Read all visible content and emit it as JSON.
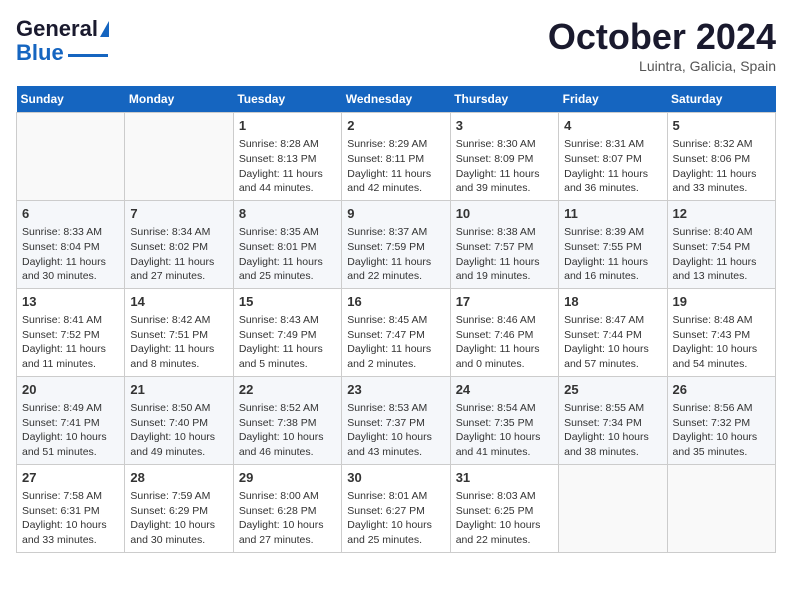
{
  "header": {
    "logo_line1": "General",
    "logo_line2": "Blue",
    "month": "October 2024",
    "location": "Luintra, Galicia, Spain"
  },
  "days_of_week": [
    "Sunday",
    "Monday",
    "Tuesday",
    "Wednesday",
    "Thursday",
    "Friday",
    "Saturday"
  ],
  "weeks": [
    [
      {
        "day": "",
        "info": ""
      },
      {
        "day": "",
        "info": ""
      },
      {
        "day": "1",
        "info": "Sunrise: 8:28 AM\nSunset: 8:13 PM\nDaylight: 11 hours and 44 minutes."
      },
      {
        "day": "2",
        "info": "Sunrise: 8:29 AM\nSunset: 8:11 PM\nDaylight: 11 hours and 42 minutes."
      },
      {
        "day": "3",
        "info": "Sunrise: 8:30 AM\nSunset: 8:09 PM\nDaylight: 11 hours and 39 minutes."
      },
      {
        "day": "4",
        "info": "Sunrise: 8:31 AM\nSunset: 8:07 PM\nDaylight: 11 hours and 36 minutes."
      },
      {
        "day": "5",
        "info": "Sunrise: 8:32 AM\nSunset: 8:06 PM\nDaylight: 11 hours and 33 minutes."
      }
    ],
    [
      {
        "day": "6",
        "info": "Sunrise: 8:33 AM\nSunset: 8:04 PM\nDaylight: 11 hours and 30 minutes."
      },
      {
        "day": "7",
        "info": "Sunrise: 8:34 AM\nSunset: 8:02 PM\nDaylight: 11 hours and 27 minutes."
      },
      {
        "day": "8",
        "info": "Sunrise: 8:35 AM\nSunset: 8:01 PM\nDaylight: 11 hours and 25 minutes."
      },
      {
        "day": "9",
        "info": "Sunrise: 8:37 AM\nSunset: 7:59 PM\nDaylight: 11 hours and 22 minutes."
      },
      {
        "day": "10",
        "info": "Sunrise: 8:38 AM\nSunset: 7:57 PM\nDaylight: 11 hours and 19 minutes."
      },
      {
        "day": "11",
        "info": "Sunrise: 8:39 AM\nSunset: 7:55 PM\nDaylight: 11 hours and 16 minutes."
      },
      {
        "day": "12",
        "info": "Sunrise: 8:40 AM\nSunset: 7:54 PM\nDaylight: 11 hours and 13 minutes."
      }
    ],
    [
      {
        "day": "13",
        "info": "Sunrise: 8:41 AM\nSunset: 7:52 PM\nDaylight: 11 hours and 11 minutes."
      },
      {
        "day": "14",
        "info": "Sunrise: 8:42 AM\nSunset: 7:51 PM\nDaylight: 11 hours and 8 minutes."
      },
      {
        "day": "15",
        "info": "Sunrise: 8:43 AM\nSunset: 7:49 PM\nDaylight: 11 hours and 5 minutes."
      },
      {
        "day": "16",
        "info": "Sunrise: 8:45 AM\nSunset: 7:47 PM\nDaylight: 11 hours and 2 minutes."
      },
      {
        "day": "17",
        "info": "Sunrise: 8:46 AM\nSunset: 7:46 PM\nDaylight: 11 hours and 0 minutes."
      },
      {
        "day": "18",
        "info": "Sunrise: 8:47 AM\nSunset: 7:44 PM\nDaylight: 10 hours and 57 minutes."
      },
      {
        "day": "19",
        "info": "Sunrise: 8:48 AM\nSunset: 7:43 PM\nDaylight: 10 hours and 54 minutes."
      }
    ],
    [
      {
        "day": "20",
        "info": "Sunrise: 8:49 AM\nSunset: 7:41 PM\nDaylight: 10 hours and 51 minutes."
      },
      {
        "day": "21",
        "info": "Sunrise: 8:50 AM\nSunset: 7:40 PM\nDaylight: 10 hours and 49 minutes."
      },
      {
        "day": "22",
        "info": "Sunrise: 8:52 AM\nSunset: 7:38 PM\nDaylight: 10 hours and 46 minutes."
      },
      {
        "day": "23",
        "info": "Sunrise: 8:53 AM\nSunset: 7:37 PM\nDaylight: 10 hours and 43 minutes."
      },
      {
        "day": "24",
        "info": "Sunrise: 8:54 AM\nSunset: 7:35 PM\nDaylight: 10 hours and 41 minutes."
      },
      {
        "day": "25",
        "info": "Sunrise: 8:55 AM\nSunset: 7:34 PM\nDaylight: 10 hours and 38 minutes."
      },
      {
        "day": "26",
        "info": "Sunrise: 8:56 AM\nSunset: 7:32 PM\nDaylight: 10 hours and 35 minutes."
      }
    ],
    [
      {
        "day": "27",
        "info": "Sunrise: 7:58 AM\nSunset: 6:31 PM\nDaylight: 10 hours and 33 minutes."
      },
      {
        "day": "28",
        "info": "Sunrise: 7:59 AM\nSunset: 6:29 PM\nDaylight: 10 hours and 30 minutes."
      },
      {
        "day": "29",
        "info": "Sunrise: 8:00 AM\nSunset: 6:28 PM\nDaylight: 10 hours and 27 minutes."
      },
      {
        "day": "30",
        "info": "Sunrise: 8:01 AM\nSunset: 6:27 PM\nDaylight: 10 hours and 25 minutes."
      },
      {
        "day": "31",
        "info": "Sunrise: 8:03 AM\nSunset: 6:25 PM\nDaylight: 10 hours and 22 minutes."
      },
      {
        "day": "",
        "info": ""
      },
      {
        "day": "",
        "info": ""
      }
    ]
  ]
}
